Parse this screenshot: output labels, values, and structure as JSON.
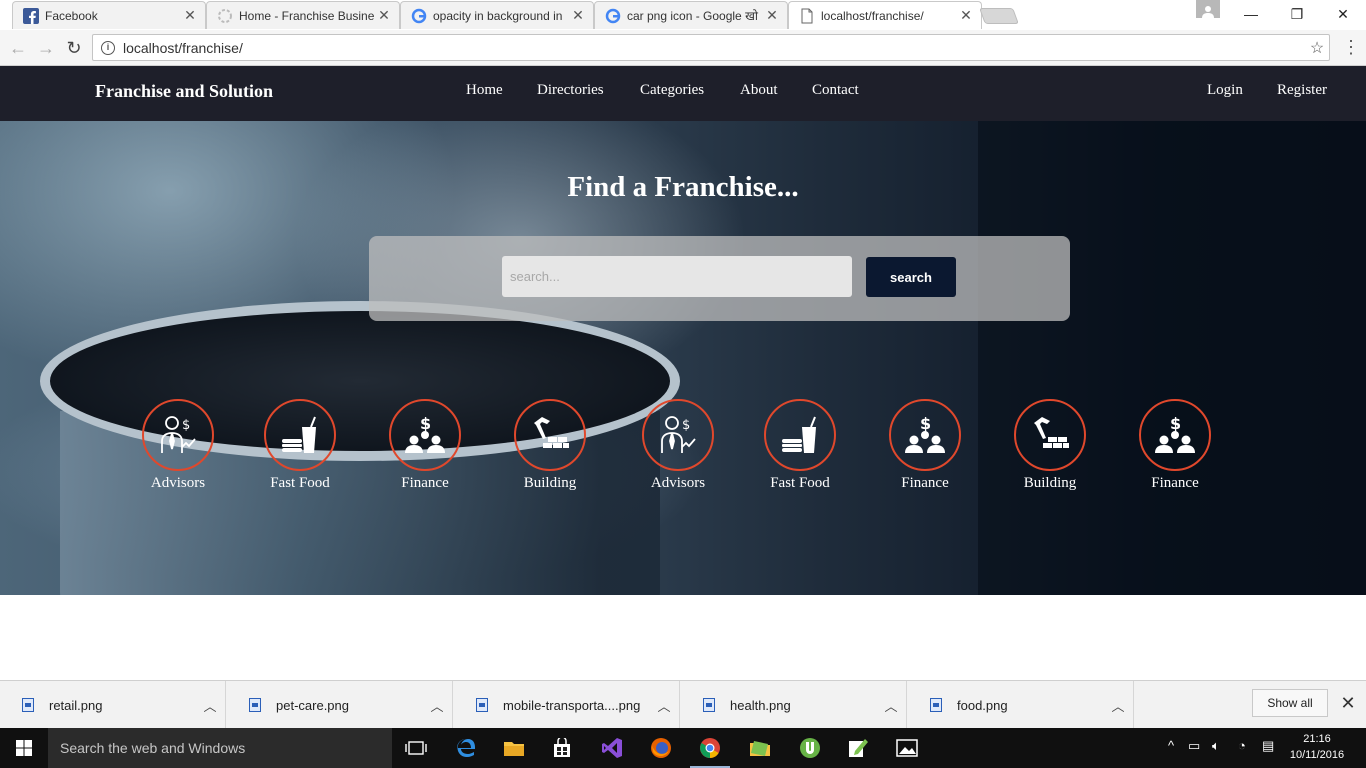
{
  "browser": {
    "tabs": [
      {
        "label": "Facebook",
        "active": false
      },
      {
        "label": "Home - Franchise Busine",
        "active": false
      },
      {
        "label": "opacity in background in",
        "active": false
      },
      {
        "label": "car png icon - Google खो",
        "active": false
      },
      {
        "label": "localhost/franchise/",
        "active": true
      }
    ],
    "address": "localhost/franchise/"
  },
  "site": {
    "brand": "Franchise and Solution",
    "nav": [
      "Home",
      "Directories",
      "Categories",
      "About",
      "Contact"
    ],
    "auth": {
      "login": "Login",
      "register": "Register"
    }
  },
  "hero": {
    "title": "Find a Franchise...",
    "search_placeholder": "search...",
    "search_button": "search",
    "categories": [
      {
        "label": "Advisors",
        "icon": "advisor-icon"
      },
      {
        "label": "Fast Food",
        "icon": "fast-food-icon"
      },
      {
        "label": "Finance",
        "icon": "finance-icon"
      },
      {
        "label": "Building",
        "icon": "building-icon"
      },
      {
        "label": "Advisors",
        "icon": "advisor-icon"
      },
      {
        "label": "Fast Food",
        "icon": "fast-food-icon"
      },
      {
        "label": "Finance",
        "icon": "finance-icon"
      },
      {
        "label": "Building",
        "icon": "building-icon"
      },
      {
        "label": "Finance",
        "icon": "finance-icon"
      }
    ],
    "accent_color": "#e0482c"
  },
  "downloads": {
    "files": [
      "retail.png",
      "pet-care.png",
      "mobile-transporta....png",
      "health.png",
      "food.png"
    ],
    "show_all": "Show all"
  },
  "taskbar": {
    "search_placeholder": "Search the web and Windows",
    "time": "21:16",
    "date": "10/11/2016"
  }
}
